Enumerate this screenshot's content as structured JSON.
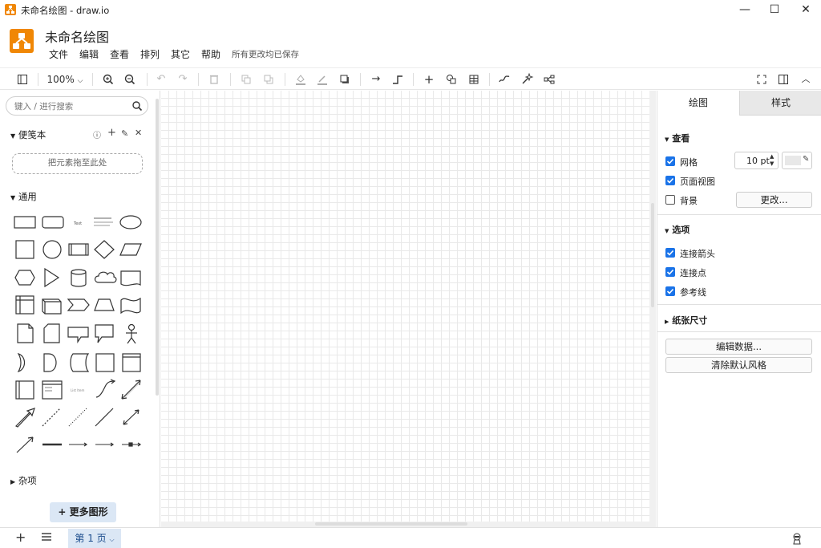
{
  "window": {
    "title": "未命名绘图 - draw.io",
    "minimize": "—",
    "maximize": "☐",
    "close": "✕"
  },
  "header": {
    "doc_title": "未命名绘图",
    "menus": [
      "文件",
      "编辑",
      "查看",
      "排列",
      "其它",
      "帮助"
    ],
    "save_status": "所有更改均已保存"
  },
  "toolbar": {
    "zoom": "100%"
  },
  "left_panel": {
    "search_placeholder": "键入 / 进行搜索",
    "scratchpad_title": "便笺本",
    "drop_zone": "把元素拖至此处",
    "general_title": "通用",
    "misc_title": "杂项",
    "more_shapes": "更多图形"
  },
  "right_panel": {
    "tabs": [
      "绘图",
      "样式"
    ],
    "view_title": "查看",
    "grid_label": "网格",
    "grid_size": "10 pt",
    "page_view_label": "页面视图",
    "background_label": "背景",
    "change_button": "更改...",
    "options_title": "选项",
    "connection_arrows": "连接箭头",
    "connection_points": "连接点",
    "guides": "参考线",
    "paper_size_title": "纸张尺寸",
    "edit_data_button": "编辑数据...",
    "clear_style_button": "清除默认风格"
  },
  "bottom": {
    "page_tab": "第 1 页"
  },
  "colors": {
    "brand": "#f08705",
    "accent": "#1a73e8",
    "tab_active": "#dbe7f5"
  }
}
